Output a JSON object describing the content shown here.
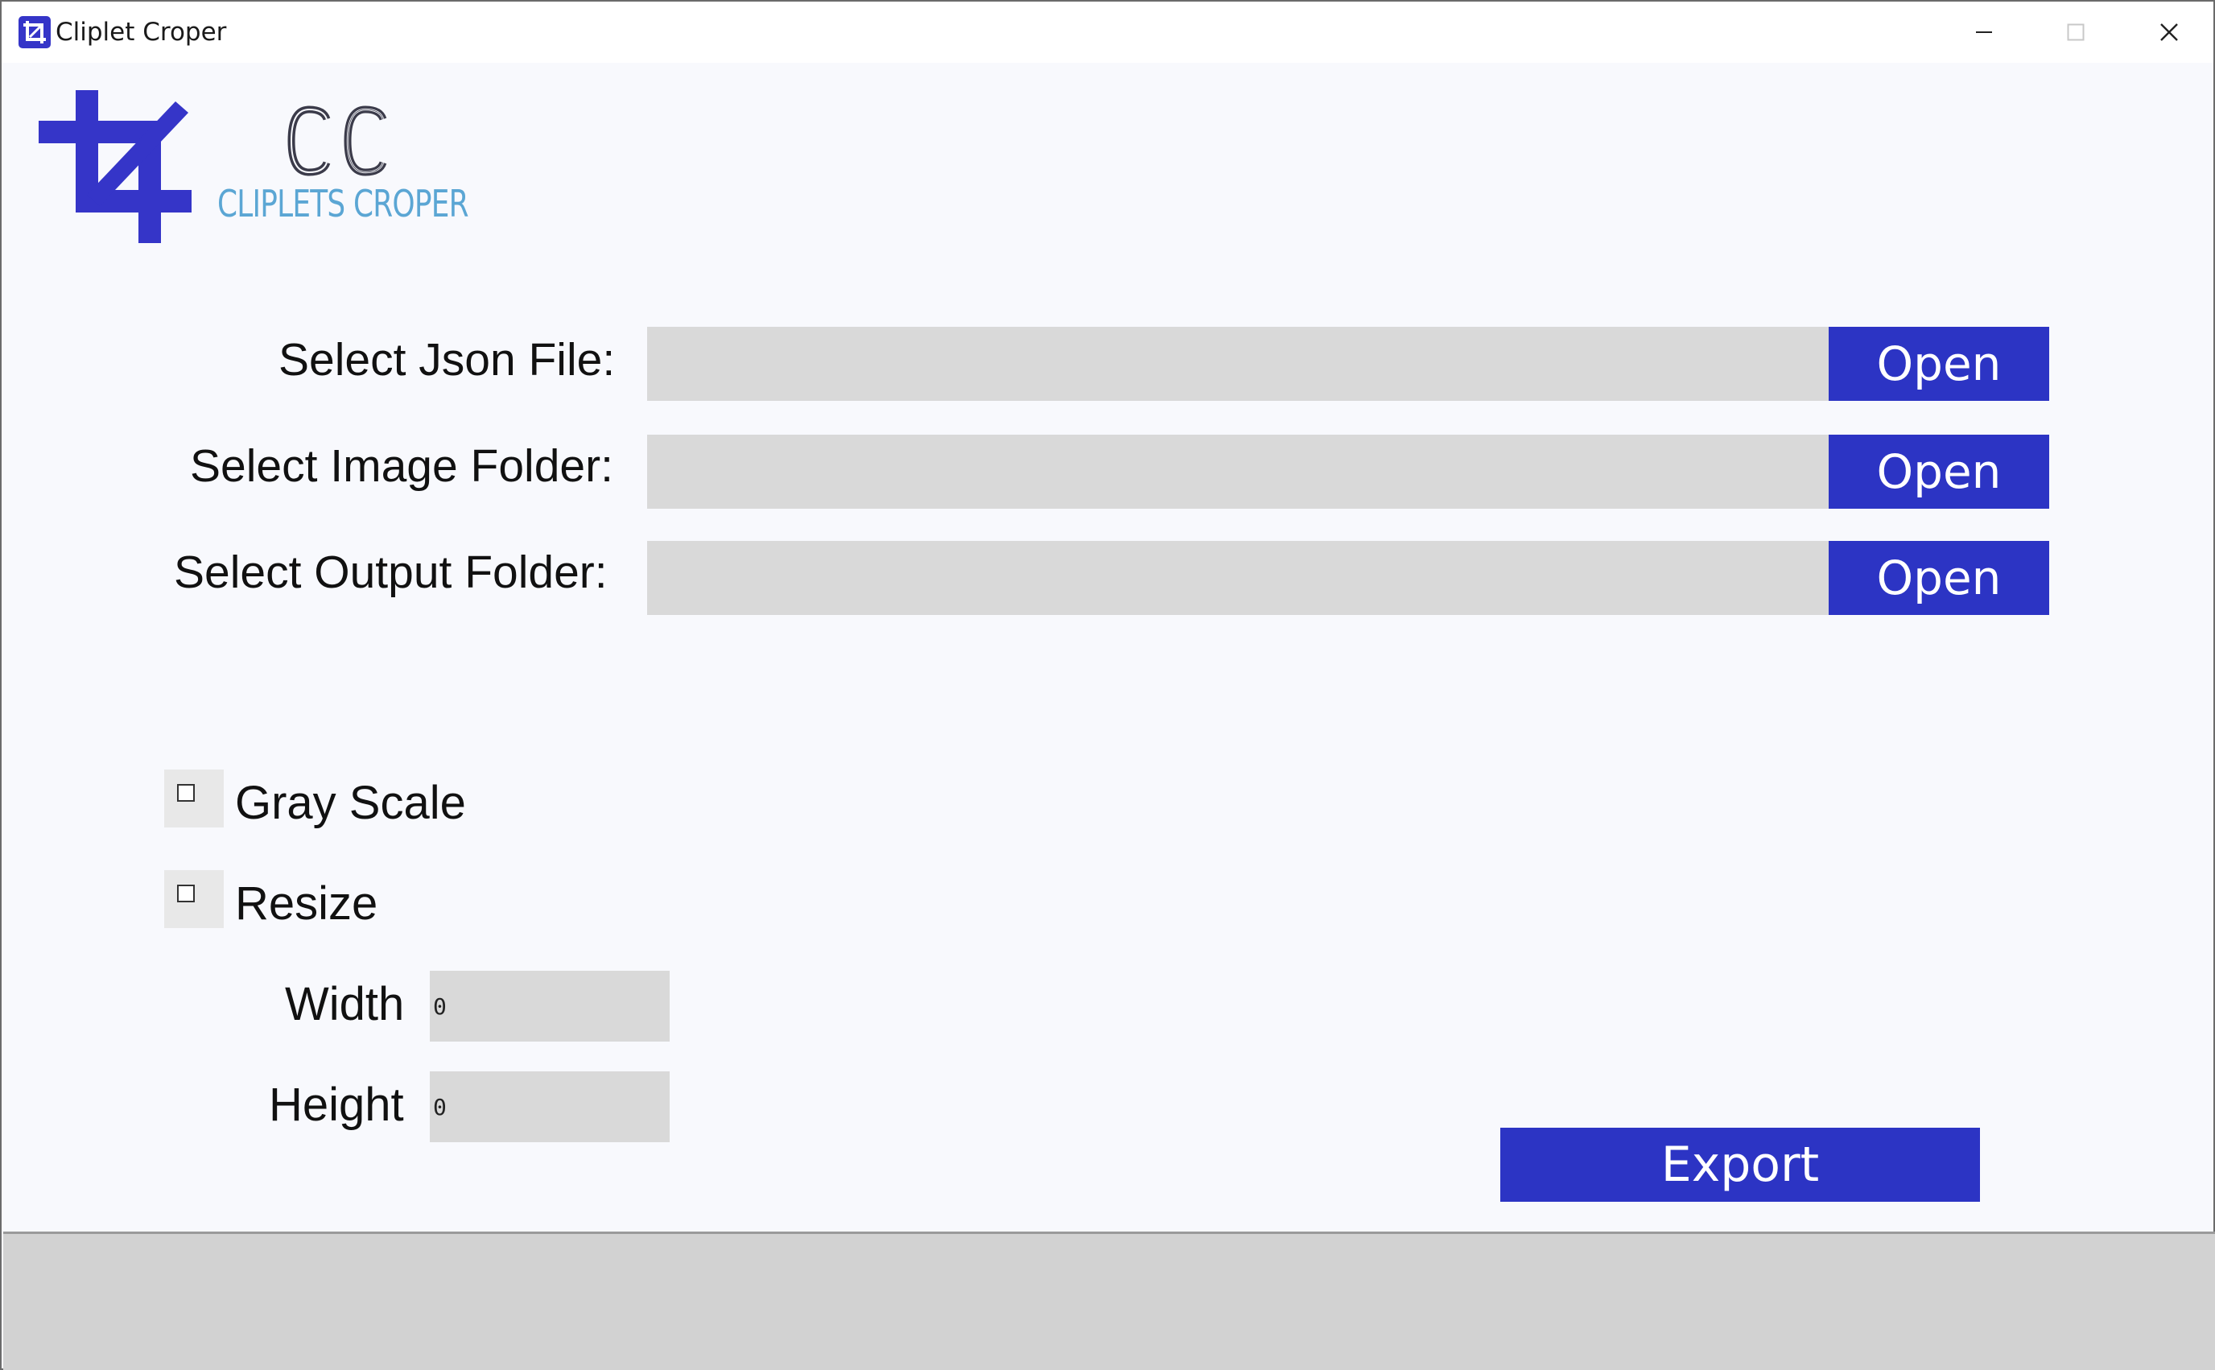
{
  "window": {
    "title": "Cliplet Croper",
    "icon": "crop-icon"
  },
  "logo": {
    "mark_icon": "crop-icon",
    "monogram": "CC",
    "text": "CLIPLETS CROPER",
    "accent_color": "#3535c8",
    "text_color": "#5ba6d4"
  },
  "selectors": [
    {
      "label": "Select Json File:",
      "value": "",
      "button": "Open"
    },
    {
      "label": "Select Image Folder:",
      "value": "",
      "button": "Open"
    },
    {
      "label": "Select Output Folder:",
      "value": "",
      "button": "Open"
    }
  ],
  "options": {
    "gray_scale": {
      "label": "Gray Scale",
      "checked": false
    },
    "resize": {
      "label": "Resize",
      "checked": false
    },
    "width": {
      "label": "Width",
      "value": "0"
    },
    "height": {
      "label": "Height",
      "value": "0"
    }
  },
  "export": {
    "label": "Export"
  },
  "colors": {
    "button_bg": "#2c34c4",
    "field_bg": "#d9d9d9",
    "status_bar_bg": "#d2d2d2"
  }
}
